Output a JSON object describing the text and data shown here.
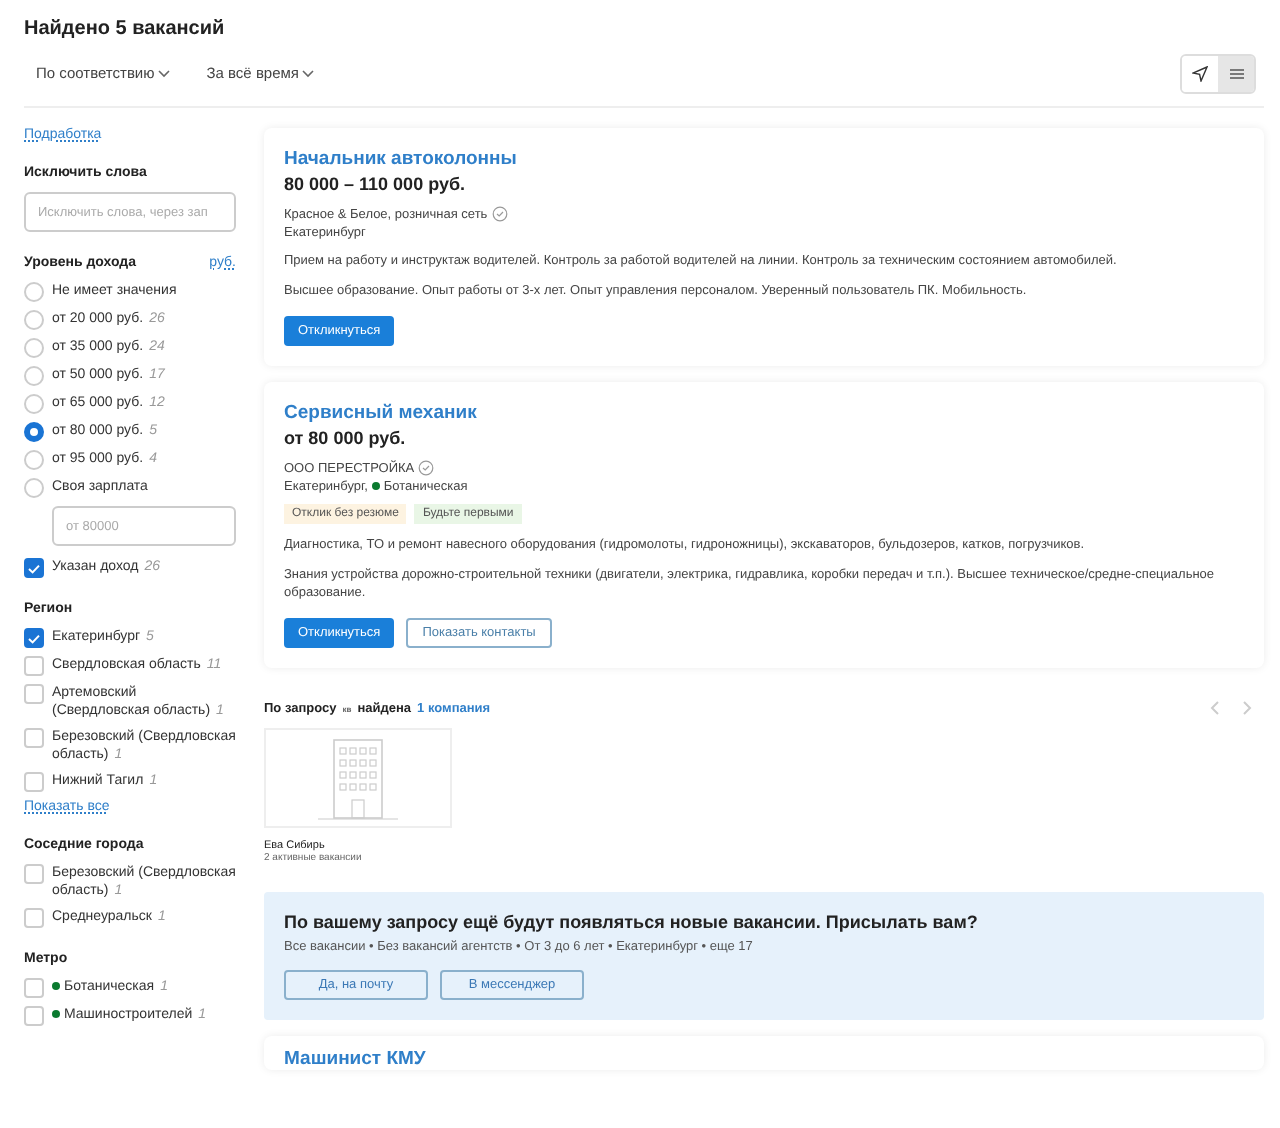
{
  "header": {
    "title": "Найдено 5 вакансий",
    "sorts": [
      "По соответствию",
      "За всё время"
    ],
    "view_toggle": [
      {
        "kind": "map",
        "selected": false
      },
      {
        "kind": "list",
        "selected": true
      }
    ]
  },
  "sidebar": {
    "part_time_link": "Подработка",
    "exclude": {
      "title": "Исключить слова",
      "placeholder": "Исключить слова, через зап"
    },
    "income": {
      "title": "Уровень дохода",
      "currency": "руб.",
      "options": [
        {
          "label": "Не имеет значения",
          "selected": false
        },
        {
          "label": "от 20 000 руб.",
          "count": "26",
          "selected": false
        },
        {
          "label": "от 35 000 руб.",
          "count": "24",
          "selected": false
        },
        {
          "label": "от 50 000 руб.",
          "count": "17",
          "selected": false
        },
        {
          "label": "от 65 000 руб.",
          "count": "12",
          "selected": false
        },
        {
          "label": "от 80 000 руб.",
          "count": "5",
          "selected": true
        },
        {
          "label": "от 95 000 руб.",
          "count": "4",
          "selected": false
        },
        {
          "label": "Своя зарплата",
          "selected": false
        }
      ],
      "custom_placeholder": "от 80000",
      "specified": {
        "label": "Указан доход",
        "count": "26",
        "checked": true
      }
    },
    "region": {
      "title": "Регион",
      "items": [
        {
          "label": "Екатеринбург",
          "count": "5",
          "checked": true
        },
        {
          "label": "Свердловская область",
          "count": "11",
          "checked": false
        },
        {
          "label": "Артемовский (Свердловская область)",
          "count": "1",
          "checked": false
        },
        {
          "label": "Березовский (Свердловская область)",
          "count": "1",
          "checked": false
        },
        {
          "label": "Нижний Тагил",
          "count": "1",
          "checked": false
        }
      ],
      "show_all": "Показать все"
    },
    "nearby": {
      "title": "Соседние города",
      "items": [
        {
          "label": "Березовский (Свердловская область)",
          "count": "1",
          "checked": false
        },
        {
          "label": "Среднеуральск",
          "count": "1",
          "checked": false
        }
      ]
    },
    "metro": {
      "title": "Метро",
      "items": [
        {
          "label": "Ботаническая",
          "count": "1",
          "checked": false,
          "color": "#0a7a2f"
        },
        {
          "label": "Машиностроителей",
          "count": "1",
          "checked": false,
          "color": "#0a7a2f"
        }
      ]
    }
  },
  "vacancies": [
    {
      "title": "Начальник автоколонны",
      "salary": "80 000 – 110 000 руб.",
      "company": "Красное & Белое, розничная сеть",
      "verified": true,
      "city": "Екатеринбург",
      "texts": [
        "Прием на работу и инструктаж водителей. Контроль за работой водителей на линии. Контроль за техническим состоянием автомобилей.",
        "Высшее образование. Опыт работы от 3-х лет. Опыт управления персоналом. Уверенный пользователь ПК. Мобильность."
      ],
      "buttons": [
        {
          "kind": "primary",
          "label": "Откликнуться"
        }
      ]
    },
    {
      "title": "Сервисный механик",
      "salary": "от 80 000 руб.",
      "company": "ООО ПЕРЕСТРОЙКА",
      "verified": true,
      "city": "Екатеринбург,",
      "metro": "Ботаническая",
      "tags": [
        {
          "label": "Отклик без резюме",
          "color": "#fdf3e1"
        },
        {
          "label": "Будьте первыми",
          "color": "#e9f6e6"
        }
      ],
      "texts": [
        "Диагностика, ТО и ремонт навесного оборудования (гидромолоты, гидроножницы), экскаваторов, бульдозеров, катков, погрузчиков.",
        "Знания устройства дорожно-строительной техники (двигатели, электрика, гидравлика, коробки передач и т.п.). Высшее техническое/средне-специальное образование."
      ],
      "buttons": [
        {
          "kind": "primary",
          "label": "Откликнуться"
        },
        {
          "kind": "outline",
          "label": "Показать контакты"
        }
      ]
    }
  ],
  "companies": {
    "prefix": "По запросу",
    "query": "кв",
    "found": "найдена",
    "link": "1 компания",
    "items": [
      {
        "name": "Ева Сибирь",
        "vacancies": "2 активные вакансии"
      }
    ]
  },
  "subscribe": {
    "title": "По вашему запросу ещё будут появляться новые вакансии. Присылать вам?",
    "filters": "Все вакансии • Без вакансий агентств • От 3 до 6 лет • Екатеринбург • еще 17",
    "buttons": [
      "Да, на почту",
      "В мессенджер"
    ]
  },
  "next_vacancy": {
    "title": "Машинист КМУ"
  }
}
